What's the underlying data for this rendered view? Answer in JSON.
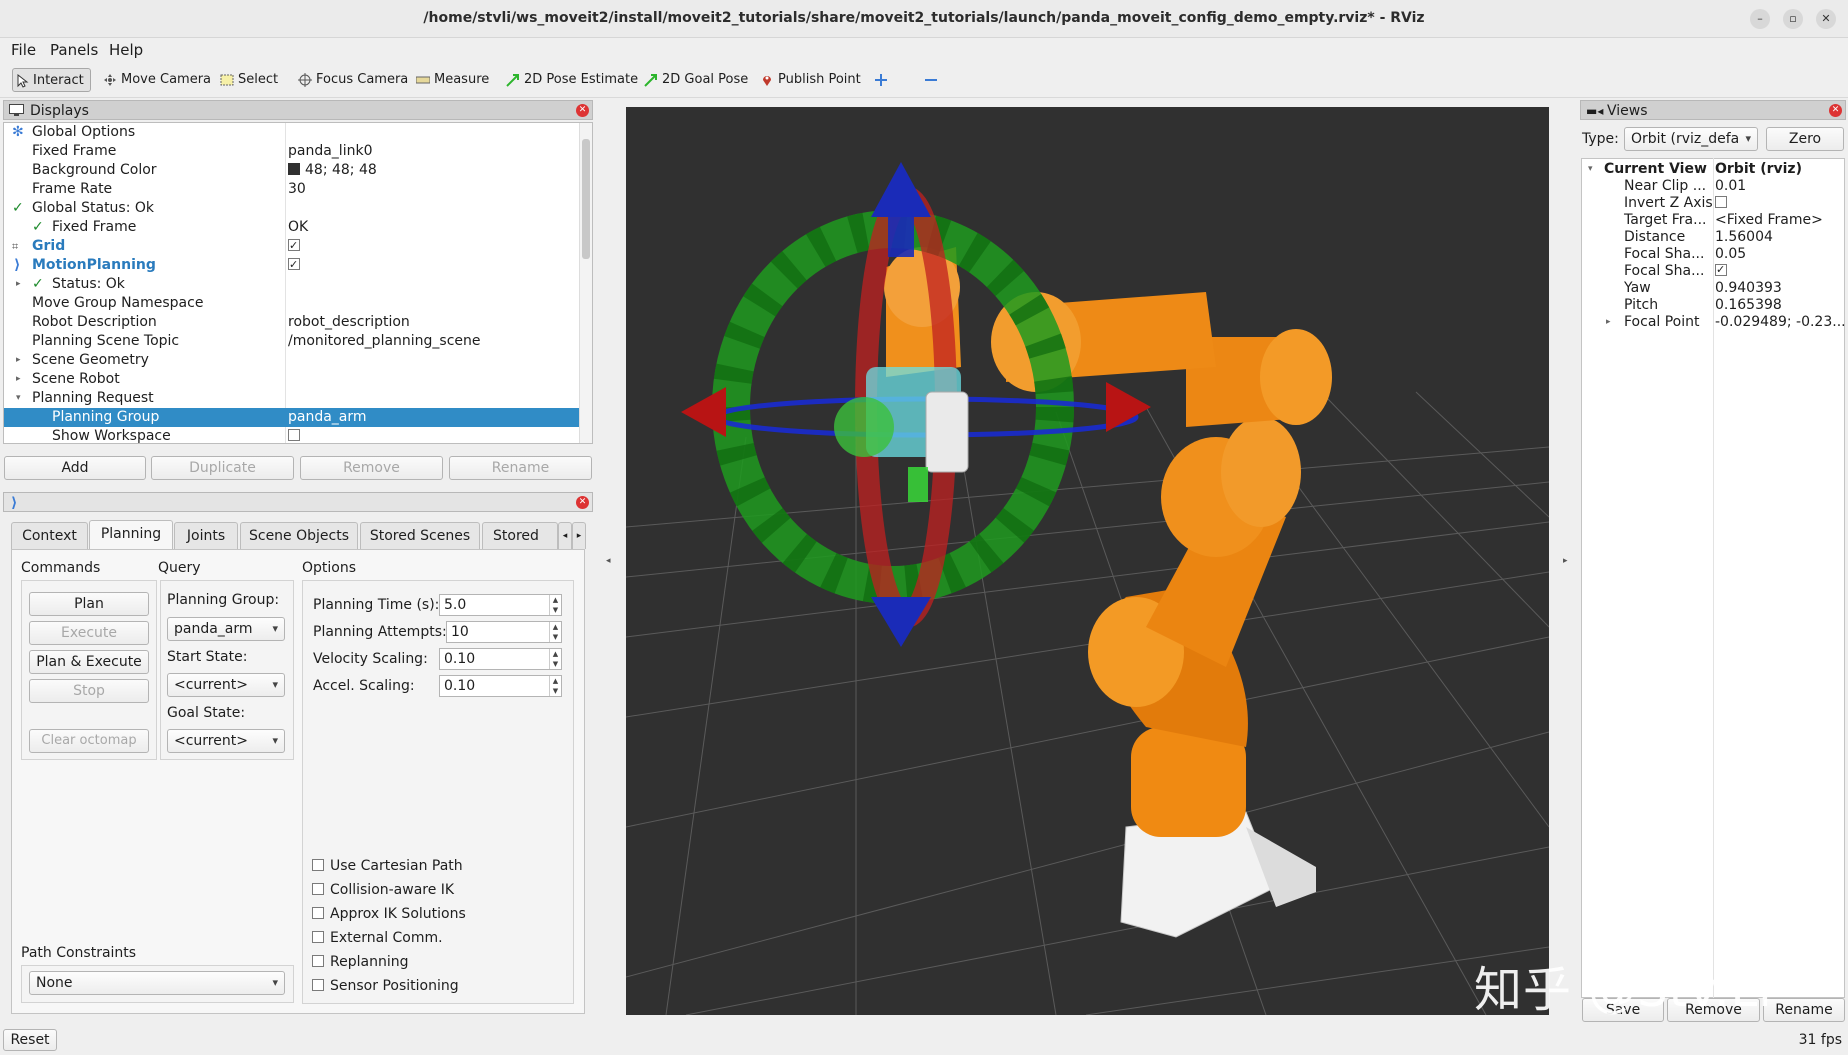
{
  "window": {
    "title": "/home/stvli/ws_moveit2/install/moveit2_tutorials/share/moveit2_tutorials/launch/panda_moveit_config_demo_empty.rviz* - RViz"
  },
  "menu": [
    "File",
    "Panels",
    "Help"
  ],
  "toolbar": {
    "tools": [
      "Interact",
      "Move Camera",
      "Select",
      "Focus Camera",
      "Measure",
      "2D Pose Estimate",
      "2D Goal Pose",
      "Publish Point"
    ],
    "active": "Interact"
  },
  "displays": {
    "title": "Displays",
    "rows": [
      {
        "label": "Global Options",
        "value": ""
      },
      {
        "label": "Fixed Frame",
        "value": "panda_link0"
      },
      {
        "label": "Background Color",
        "value": "48; 48; 48"
      },
      {
        "label": "Frame Rate",
        "value": "30"
      },
      {
        "label": "Global Status: Ok",
        "value": ""
      },
      {
        "label": "Fixed Frame",
        "value": "OK"
      },
      {
        "label": "Grid",
        "value": ""
      },
      {
        "label": "MotionPlanning",
        "value": ""
      },
      {
        "label": "Status: Ok",
        "value": ""
      },
      {
        "label": "Move Group Namespace",
        "value": ""
      },
      {
        "label": "Robot Description",
        "value": "robot_description"
      },
      {
        "label": "Planning Scene Topic",
        "value": "/monitored_planning_scene"
      },
      {
        "label": "Scene Geometry",
        "value": ""
      },
      {
        "label": "Scene Robot",
        "value": ""
      },
      {
        "label": "Planning Request",
        "value": ""
      },
      {
        "label": "Planning Group",
        "value": "panda_arm"
      },
      {
        "label": "Show Workspace",
        "value": ""
      }
    ],
    "background_color": "#303030",
    "buttons": [
      "Add",
      "Duplicate",
      "Remove",
      "Rename"
    ]
  },
  "motion_planning": {
    "tabs": [
      "Context",
      "Planning",
      "Joints",
      "Scene Objects",
      "Stored Scenes",
      "Stored St"
    ],
    "active_tab": "Planning",
    "commands_label": "Commands",
    "commands": [
      "Plan",
      "Execute",
      "Plan & Execute",
      "Stop",
      "Clear octomap"
    ],
    "query_label": "Query",
    "planning_group_label": "Planning Group:",
    "planning_group": "panda_arm",
    "start_state_label": "Start State:",
    "start_state": "<current>",
    "goal_state_label": "Goal State:",
    "goal_state": "<current>",
    "options_label": "Options",
    "planning_time_label": "Planning Time (s):",
    "planning_time": "5.0",
    "planning_attempts_label": "Planning Attempts:",
    "planning_attempts": "10",
    "velocity_scaling_label": "Velocity Scaling:",
    "velocity_scaling": "0.10",
    "accel_scaling_label": "Accel. Scaling:",
    "accel_scaling": "0.10",
    "checkboxes": [
      "Use Cartesian Path",
      "Collision-aware IK",
      "Approx IK Solutions",
      "External Comm.",
      "Replanning",
      "Sensor Positioning"
    ],
    "path_constraints_label": "Path Constraints",
    "path_constraints": "None"
  },
  "views": {
    "title": "Views",
    "type_label": "Type:",
    "type_value": "Orbit (rviz_defa",
    "zero_label": "Zero",
    "rows": [
      {
        "label": "Current View",
        "value": "Orbit (rviz)"
      },
      {
        "label": "Near Clip ...",
        "value": "0.01"
      },
      {
        "label": "Invert Z Axis",
        "value": ""
      },
      {
        "label": "Target Fra...",
        "value": "<Fixed Frame>"
      },
      {
        "label": "Distance",
        "value": "1.56004"
      },
      {
        "label": "Focal Sha...",
        "value": "0.05"
      },
      {
        "label": "Focal Sha...",
        "value": ""
      },
      {
        "label": "Yaw",
        "value": "0.940393"
      },
      {
        "label": "Pitch",
        "value": "0.165398"
      },
      {
        "label": "Focal Point",
        "value": "-0.029489; -0.23..."
      }
    ],
    "buttons": [
      "Save",
      "Remove",
      "Rename"
    ]
  },
  "status": {
    "reset": "Reset",
    "fps": "31 fps"
  },
  "watermark": "知乎 @Stv.Li"
}
